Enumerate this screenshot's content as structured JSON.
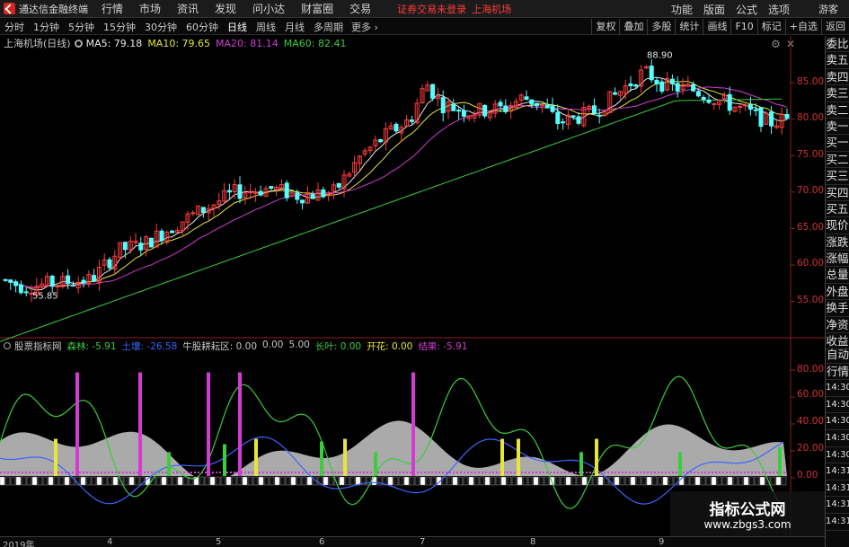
{
  "menu": {
    "app_title": "通达信金融终端",
    "items": [
      "行情",
      "市场",
      "资讯",
      "发现",
      "问小达",
      "财富圈",
      "交易"
    ],
    "warning": "证券交易未登录",
    "stock": "上海机场",
    "right_items": [
      "功能",
      "版面",
      "公式",
      "选项"
    ],
    "guest": "游客"
  },
  "periods": [
    "分时",
    "1分钟",
    "5分钟",
    "15分钟",
    "30分钟",
    "60分钟",
    "日线",
    "周线",
    "月线",
    "多周期",
    "更多"
  ],
  "active_period": "日线",
  "tools": [
    "复权",
    "叠加",
    "多股",
    "统计",
    "画线",
    "F10",
    "标记",
    "+自选",
    "返回"
  ],
  "main_chart": {
    "stock_name": "上海机场(日线)",
    "ma5": "MA5: 79.18",
    "ma10": "MA10: 79.65",
    "ma20": "MA20: 81.14",
    "ma60": "MA60: 82.41",
    "price_labels": [
      "85.00",
      "80.00",
      "75.00",
      "70.00",
      "65.00",
      "60.00",
      "55.00"
    ],
    "high_marker": "88.90",
    "low_marker": "55.85",
    "colors": {
      "up": "#ff3c3c",
      "down": "#54ffff",
      "ma5": "#e8e8e8",
      "ma10": "#e6e63a",
      "ma20": "#d23cd2",
      "ma60": "#3ccc3c"
    }
  },
  "indicator": {
    "title": "股票指标网",
    "items": [
      {
        "label": "森林: -5.91",
        "color": "#3ccc3c"
      },
      {
        "label": "土壤: -26.58",
        "color": "#3c64ff"
      },
      {
        "label": "牛股耕耘区: 0.00",
        "color": "#c8c8c8"
      },
      {
        "label": "0.00",
        "color": "#c8c8c8"
      },
      {
        "label": "5.00",
        "color": "#c8c8c8"
      },
      {
        "label": "长叶: 0.00",
        "color": "#3ccc3c"
      },
      {
        "label": "开花: 0.00",
        "color": "#e6e63a"
      },
      {
        "label": "结果: -5.91",
        "color": "#d23cd2"
      }
    ],
    "axis_labels": [
      "80.00",
      "60.00",
      "40.00",
      "20.00",
      "0.00"
    ]
  },
  "sidebar": {
    "top_items": [
      "委比",
      "卖五",
      "卖四",
      "卖三",
      "卖二",
      "卖一",
      "买一",
      "买二",
      "买三",
      "买四",
      "买五",
      "现价",
      "涨跌",
      "涨幅",
      "总量",
      "外盘",
      "换手",
      "净资",
      "收益"
    ],
    "bottom_items": [
      "自动",
      "行情",
      "14:30",
      "14:30",
      "14:30",
      "14:30",
      "14:30",
      "14:31",
      "14:31",
      "14:31",
      "14:31"
    ]
  },
  "dates": [
    "2019年",
    "4",
    "5",
    "6",
    "7",
    "8",
    "9"
  ],
  "watermark": {
    "title": "指标公式网",
    "url": "www.zbgs3.com"
  }
}
